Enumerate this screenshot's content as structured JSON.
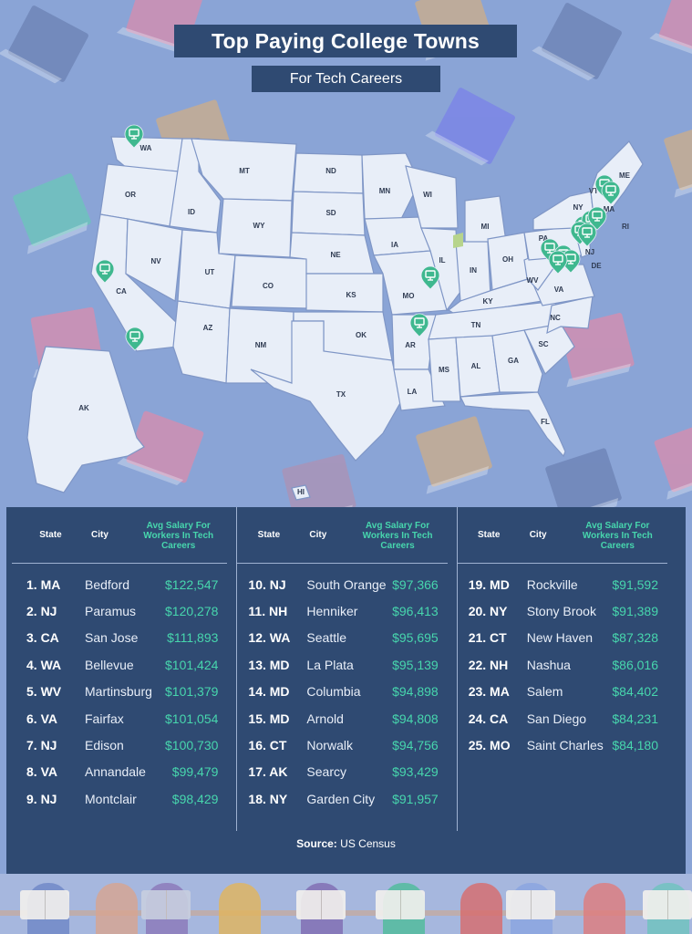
{
  "header": {
    "title": "Top Paying College Towns",
    "subtitle": "For Tech Careers"
  },
  "colors": {
    "background": "#8aa4d6",
    "panel": "#2f4a72",
    "accent_teal": "#47d6ad",
    "map_land": "#e8eef8",
    "map_border": "#7f96c6",
    "marker": "#3fb88f"
  },
  "map": {
    "state_labels": [
      "WA",
      "OR",
      "CA",
      "ID",
      "NV",
      "MT",
      "WY",
      "UT",
      "AZ",
      "CO",
      "NM",
      "ND",
      "SD",
      "NE",
      "KS",
      "OK",
      "TX",
      "MN",
      "IA",
      "MO",
      "AR",
      "LA",
      "WI",
      "IL",
      "MI",
      "IN",
      "OH",
      "KY",
      "TN",
      "MS",
      "AL",
      "GA",
      "FL",
      "SC",
      "NC",
      "VA",
      "WV",
      "PA",
      "NY",
      "VT",
      "ME",
      "MA",
      "RI",
      "NJ",
      "DE",
      "AK",
      "HI"
    ],
    "marker_icon": "computer-monitor-icon",
    "marker_count": 25
  },
  "table": {
    "headers": {
      "state": "State",
      "city": "City",
      "salary": "Avg Salary For Workers In Tech Careers"
    },
    "columns": [
      [
        {
          "rank": "1. MA",
          "city": "Bedford",
          "salary": "$122,547"
        },
        {
          "rank": "2. NJ",
          "city": "Paramus",
          "salary": "$120,278"
        },
        {
          "rank": "3. CA",
          "city": "San Jose",
          "salary": "$111,893"
        },
        {
          "rank": "4. WA",
          "city": "Bellevue",
          "salary": "$101,424"
        },
        {
          "rank": "5. WV",
          "city": "Martinsburg",
          "salary": "$101,379"
        },
        {
          "rank": "6. VA",
          "city": "Fairfax",
          "salary": "$101,054"
        },
        {
          "rank": "7. NJ",
          "city": "Edison",
          "salary": "$100,730"
        },
        {
          "rank": "8. VA",
          "city": "Annandale",
          "salary": "$99,479"
        },
        {
          "rank": "9. NJ",
          "city": "Montclair",
          "salary": "$98,429"
        }
      ],
      [
        {
          "rank": "10. NJ",
          "city": "South Orange",
          "salary": "$97,366"
        },
        {
          "rank": "11. NH",
          "city": "Henniker",
          "salary": "$96,413"
        },
        {
          "rank": "12. WA",
          "city": "Seattle",
          "salary": "$95,695"
        },
        {
          "rank": "13. MD",
          "city": "La Plata",
          "salary": "$95,139"
        },
        {
          "rank": "14. MD",
          "city": "Columbia",
          "salary": "$94,898"
        },
        {
          "rank": "15. MD",
          "city": "Arnold",
          "salary": "$94,808"
        },
        {
          "rank": "16. CT",
          "city": "Norwalk",
          "salary": "$94,756"
        },
        {
          "rank": "17. AK",
          "city": "Searcy",
          "salary": "$93,429"
        },
        {
          "rank": "18. NY",
          "city": "Garden City",
          "salary": "$91,957"
        }
      ],
      [
        {
          "rank": "19. MD",
          "city": "Rockville",
          "salary": "$91,592"
        },
        {
          "rank": "20. NY",
          "city": "Stony Brook",
          "salary": "$91,389"
        },
        {
          "rank": "21. CT",
          "city": "New Haven",
          "salary": "$87,328"
        },
        {
          "rank": "22. NH",
          "city": "Nashua",
          "salary": "$86,016"
        },
        {
          "rank": "23. MA",
          "city": "Salem",
          "salary": "$84,402"
        },
        {
          "rank": "24. CA",
          "city": "San Diego",
          "salary": "$84,231"
        },
        {
          "rank": "25. MO",
          "city": "Saint Charles",
          "salary": "$84,180"
        }
      ]
    ]
  },
  "source": {
    "label": "Source:",
    "value": "US Census"
  }
}
